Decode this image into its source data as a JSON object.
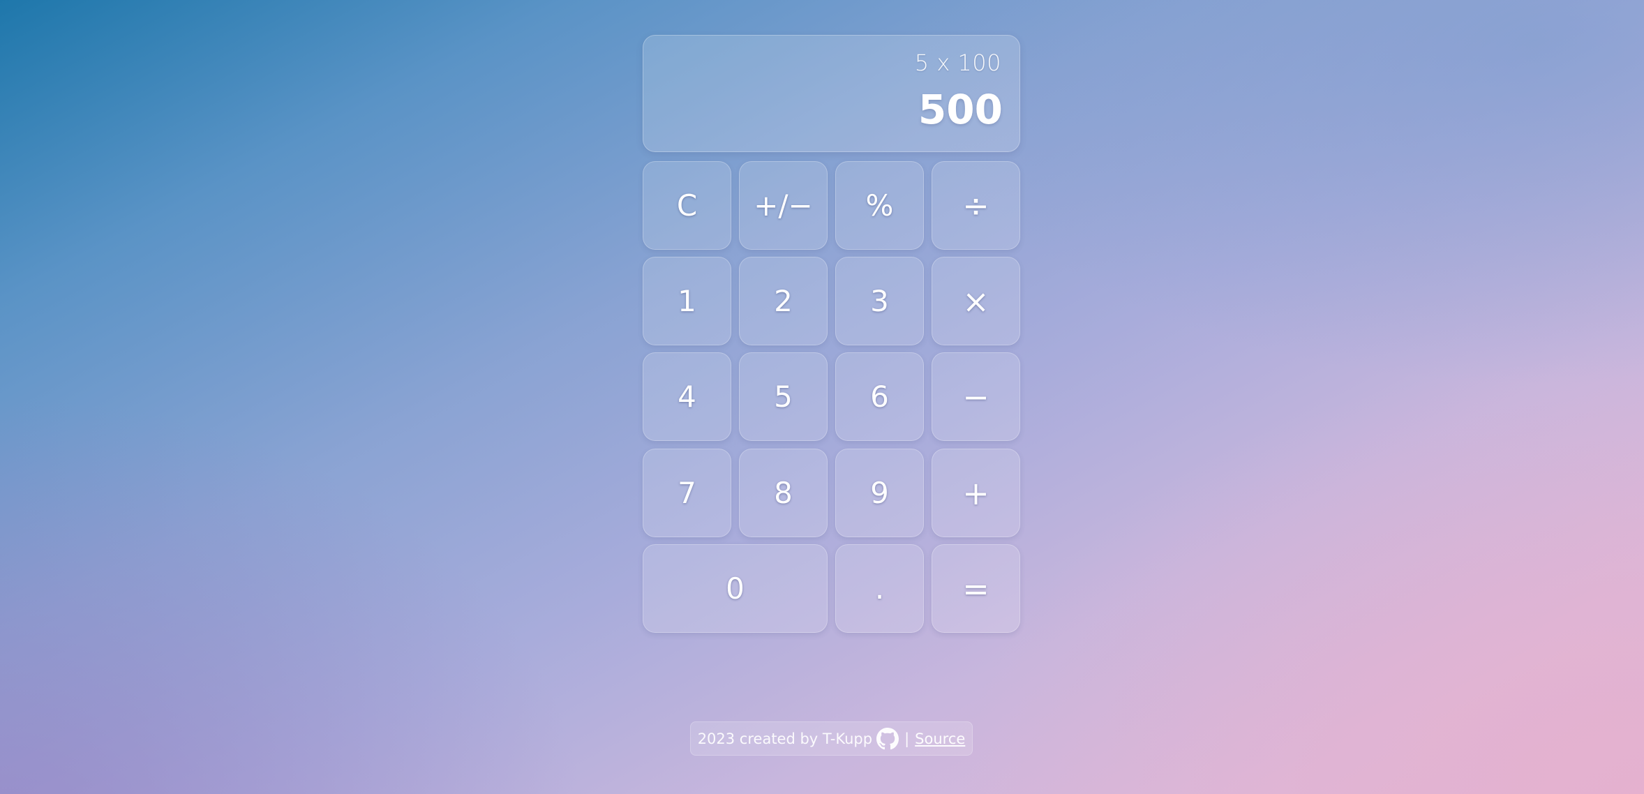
{
  "display": {
    "expression": "5 x 100",
    "result": "500"
  },
  "keys": {
    "clear": "C",
    "sign": "+/−",
    "percent": "%",
    "divide": "÷",
    "one": "1",
    "two": "2",
    "three": "3",
    "multiply": "×",
    "four": "4",
    "five": "5",
    "six": "6",
    "subtract": "−",
    "seven": "7",
    "eight": "8",
    "nine": "9",
    "add": "+",
    "zero": "0",
    "decimal": ".",
    "equals": "="
  },
  "footer": {
    "credit": "2023 created by T-Kupp",
    "icon": "github-icon",
    "separator": "|",
    "source_link": "Source"
  }
}
